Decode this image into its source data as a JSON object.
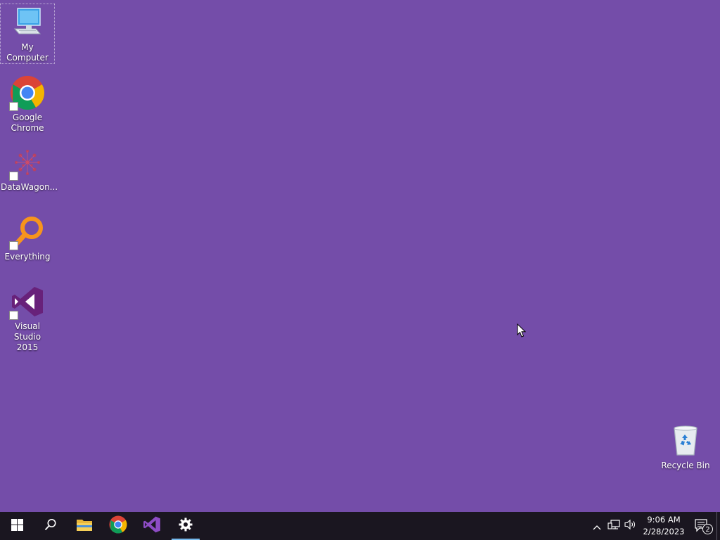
{
  "desktop": {
    "background_color": "#744da9",
    "icons": [
      {
        "label": "My Computer",
        "icon": "computer-icon"
      },
      {
        "label": "Google\nChrome",
        "icon": "chrome-icon"
      },
      {
        "label": "DataWagon...",
        "icon": "datawagon-icon"
      },
      {
        "label": "Everything",
        "icon": "everything-search-icon"
      },
      {
        "label": "Visual Studio\n2015",
        "icon": "visual-studio-icon"
      },
      {
        "label": "Recycle Bin",
        "icon": "recycle-bin-icon"
      }
    ]
  },
  "taskbar": {
    "background_color": "#1a1620",
    "buttons": [
      {
        "name": "start",
        "icon": "windows-logo-icon"
      },
      {
        "name": "search",
        "icon": "search-icon"
      },
      {
        "name": "file-explorer",
        "icon": "folder-icon"
      },
      {
        "name": "chrome",
        "icon": "chrome-icon"
      },
      {
        "name": "visual-studio",
        "icon": "visual-studio-icon"
      },
      {
        "name": "settings",
        "icon": "gear-icon",
        "active": true
      }
    ],
    "tray": {
      "clock_time": "9:06 AM",
      "clock_date": "2/28/2023",
      "notification_count": "2"
    }
  }
}
